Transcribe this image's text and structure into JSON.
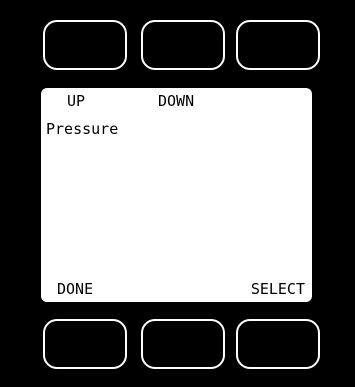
{
  "screen": {
    "top_left_label": "UP",
    "top_middle_label": "DOWN",
    "top_right_label": "",
    "menu_items": [
      "Pressure"
    ],
    "bottom_left_label": "DONE",
    "bottom_middle_label": "",
    "bottom_right_label": "SELECT"
  },
  "colors": {
    "bezel": "#000000",
    "display_background": "#ffffff",
    "text": "#000000",
    "button_outline": "#ffffff"
  }
}
